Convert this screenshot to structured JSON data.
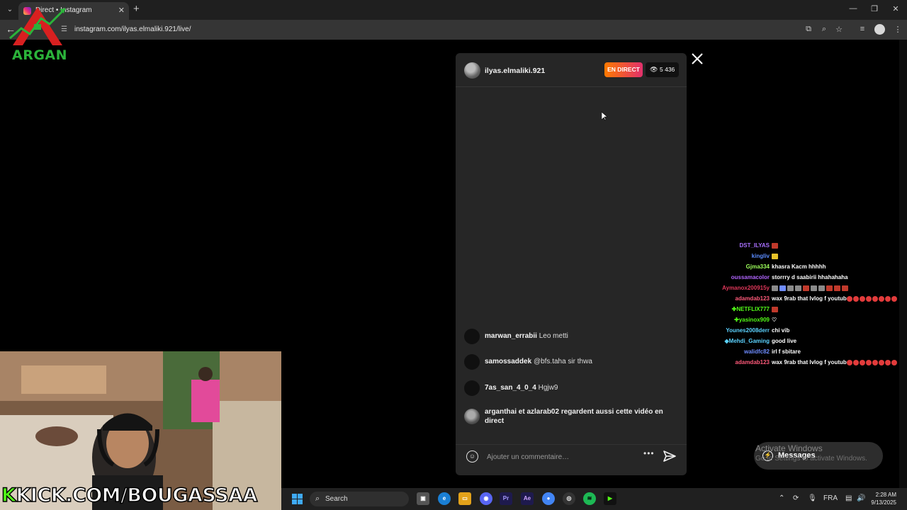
{
  "browser": {
    "tab_title": "Direct • Instagram",
    "url": "instagram.com/ilyas.elmaliki.921/live/"
  },
  "overlay": {
    "logo_text": "ARGAN",
    "brand_prefix": "K",
    "brand_text": "KICK.COM/BOUGASSAA"
  },
  "live": {
    "host": "ilyas.elmaliki.921",
    "badge": "EN DIRECT",
    "viewers": "5 436",
    "comments": [
      {
        "user": "marwan_errabii",
        "text": "Leo metti"
      },
      {
        "user": "samossaddek",
        "text": "@bfs.taha sir thwa"
      },
      {
        "user": "7as_san_4_0_4",
        "text": "Hgjw9"
      }
    ],
    "join_note": "arganthai et azlarab02 regardent aussi cette vidéo en direct",
    "comment_placeholder": "Ajouter un commentaire…"
  },
  "stream_chat": [
    {
      "user": "DST_ILYAS",
      "color": "#a970ff",
      "text": ""
    },
    {
      "user": "kingliv",
      "color": "#5b8cff",
      "text": ""
    },
    {
      "user": "Gjma334",
      "color": "#9dff5b",
      "text": "khasra Kacm hhhhh"
    },
    {
      "user": "oussamacolor",
      "color": "#b266ff",
      "text": "storrry d saabirii hhahahaha"
    },
    {
      "user": "Aymanox200915y",
      "color": "#e0375a",
      "text": ""
    },
    {
      "user": "adamdab123",
      "color": "#ff5a7a",
      "text": "wax 9rab that lvlog f youtub"
    },
    {
      "user": "NETFLIX777",
      "color": "#53fc18",
      "text": ""
    },
    {
      "user": "yasinox909",
      "color": "#53fc18",
      "text": ""
    },
    {
      "user": "Younes2008derr",
      "color": "#5bd2ff",
      "text": "chi vib"
    },
    {
      "user": "Mehdi_Gaming",
      "color": "#5bd2ff",
      "text": "good live"
    },
    {
      "user": "walidfc82",
      "color": "#6f8cff",
      "text": "irl f sbitare"
    },
    {
      "user": "adamdab123",
      "color": "#ff5a7a",
      "text": "wax 9rab that lvlog f youtub"
    }
  ],
  "windows": {
    "activate_title": "Activate Windows",
    "activate_sub": "Go to Settings to activate Windows.",
    "messages_label": "Messages",
    "search_placeholder": "Search",
    "lang": "FRA",
    "time": "2:28 AM",
    "date": "9/13/2025"
  }
}
